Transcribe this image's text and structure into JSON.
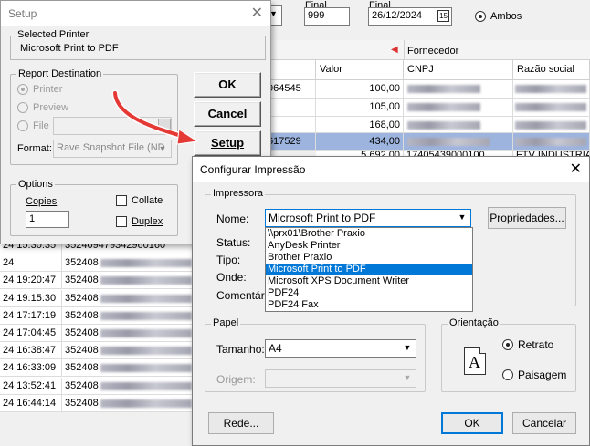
{
  "background": {
    "final_labels": [
      "Final",
      "Final"
    ],
    "final_number": "999",
    "final_date": "26/12/2024",
    "calendar_icon_text": "15",
    "radio_ambos": "Ambos",
    "fornecedor_header": "Fornecedor",
    "columns": {
      "valor": "Valor",
      "cnpj": "CNPJ",
      "razao": "Razão social"
    },
    "top_rows": [
      {
        "doc": "964545",
        "valor": "100,00"
      },
      {
        "doc": "",
        "valor": "105,00"
      },
      {
        "doc": "",
        "valor": "168,00"
      },
      {
        "doc": "617529",
        "valor": "434,00"
      },
      {
        "doc": "",
        "valor": "5.692,00"
      }
    ],
    "partial_row_text": "17405439000100",
    "partial_row_razao": "FTV INDUSTRIA",
    "bottom_rows": [
      {
        "time": "24 15:30:35",
        "num": "352409479342960160"
      },
      {
        "time": "24",
        "num": "352408"
      },
      {
        "time": "24 19:20:47",
        "num": "352408"
      },
      {
        "time": "24 19:15:30",
        "num": "352408"
      },
      {
        "time": "24 17:17:19",
        "num": "352408"
      },
      {
        "time": "24 17:04:45",
        "num": "352408"
      },
      {
        "time": "24 16:38:47",
        "num": "352408"
      },
      {
        "time": "24 16:33:09",
        "num": "352408"
      },
      {
        "time": "24 13:52:41",
        "num": "352408"
      },
      {
        "time": "24 16:44:14",
        "num": "352408"
      }
    ]
  },
  "setup_dialog": {
    "title": "Setup",
    "selected_printer_label": "Selected Printer",
    "selected_printer_value": "Microsoft Print to PDF",
    "report_destination_label": "Report Destination",
    "radio_printer": "Printer",
    "radio_preview": "Preview",
    "radio_file": "File",
    "format_label": "Format:",
    "format_value": "Rave Snapshot File (ND",
    "options_label": "Options",
    "copies_label": "Copies",
    "copies_value": "1",
    "collate_label": "Collate",
    "duplex_label": "Duplex",
    "ok_label": "OK",
    "cancel_label": "Cancel",
    "setup_label": "Setup"
  },
  "print_dialog": {
    "title": "Configurar Impressão",
    "impressora_label": "Impressora",
    "nome_label": "Nome:",
    "nome_value": "Microsoft Print to PDF",
    "propriedades_label": "Propriedades...",
    "status_label": "Status:",
    "tipo_label": "Tipo:",
    "onde_label": "Onde:",
    "comentario_label": "Comentário",
    "printer_options": [
      "\\\\prx01\\Brother Praxio",
      "AnyDesk Printer",
      "Brother Praxio",
      "Microsoft Print to PDF",
      "Microsoft XPS Document Writer",
      "PDF24",
      "PDF24 Fax"
    ],
    "selected_option_index": 3,
    "papel_label": "Papel",
    "tamanho_label": "Tamanho:",
    "tamanho_value": "A4",
    "origem_label": "Origem:",
    "origem_value": "",
    "orientacao_label": "Orientação",
    "orientation_icon_letter": "A",
    "retrato_label": "Retrato",
    "paisagem_label": "Paisagem",
    "rede_label": "Rede...",
    "ok_label": "OK",
    "cancelar_label": "Cancelar"
  },
  "colors": {
    "selected_row": "#9db4de",
    "list_selection": "#0078d7",
    "arrow": "#e53935"
  }
}
